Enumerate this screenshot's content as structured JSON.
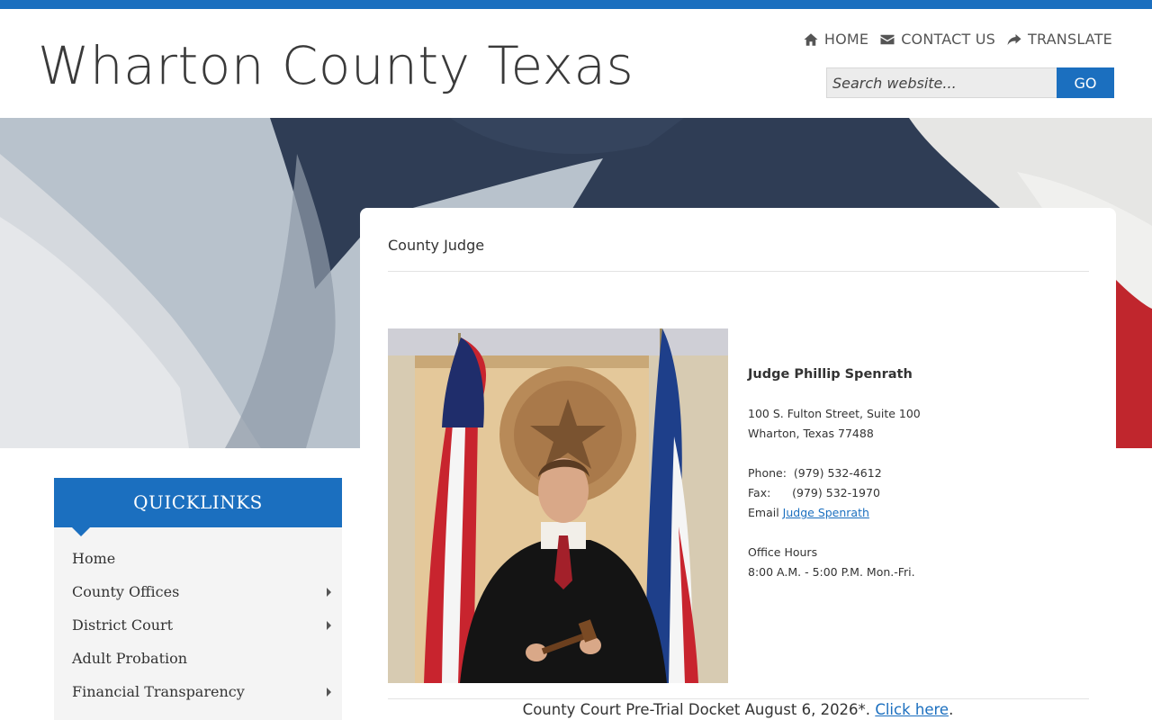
{
  "header": {
    "site_title": "Wharton County Texas",
    "nav": [
      {
        "label": "HOME",
        "icon": "home-icon"
      },
      {
        "label": "CONTACT US",
        "icon": "envelope-icon"
      },
      {
        "label": "TRANSLATE",
        "icon": "share-arrow-icon"
      }
    ],
    "search": {
      "placeholder": "Search website...",
      "button_label": "GO"
    }
  },
  "page": {
    "title": "County Judge",
    "judge_name": "Judge Phillip Spenrath",
    "address_line1": "100 S. Fulton Street, Suite 100",
    "address_line2": "Wharton, Texas 77488",
    "phone": "Phone:  (979) 532-4612",
    "fax": "Fax:      (979) 532-1970",
    "email_label": "Email",
    "email_link": "Judge Spenrath",
    "hours_label": "Office Hours",
    "hours": "8:00 A.M. - 5:00 P.M. Mon.-Fri.",
    "docket_text": "County Court Pre-Trial Docket August 6, 2026*.",
    "docket_link": "Click here",
    "docket_end": "."
  },
  "quicklinks": {
    "title": "QUICKLINKS",
    "items": [
      {
        "label": "Home",
        "has_submenu": false
      },
      {
        "label": "County Offices",
        "has_submenu": true
      },
      {
        "label": "District Court",
        "has_submenu": true
      },
      {
        "label": "Adult Probation",
        "has_submenu": false
      },
      {
        "label": "Financial Transparency",
        "has_submenu": true
      }
    ]
  },
  "colors": {
    "accent": "#1b6fbf",
    "flag_blue": "#2f3d55",
    "flag_red": "#c0262d"
  }
}
